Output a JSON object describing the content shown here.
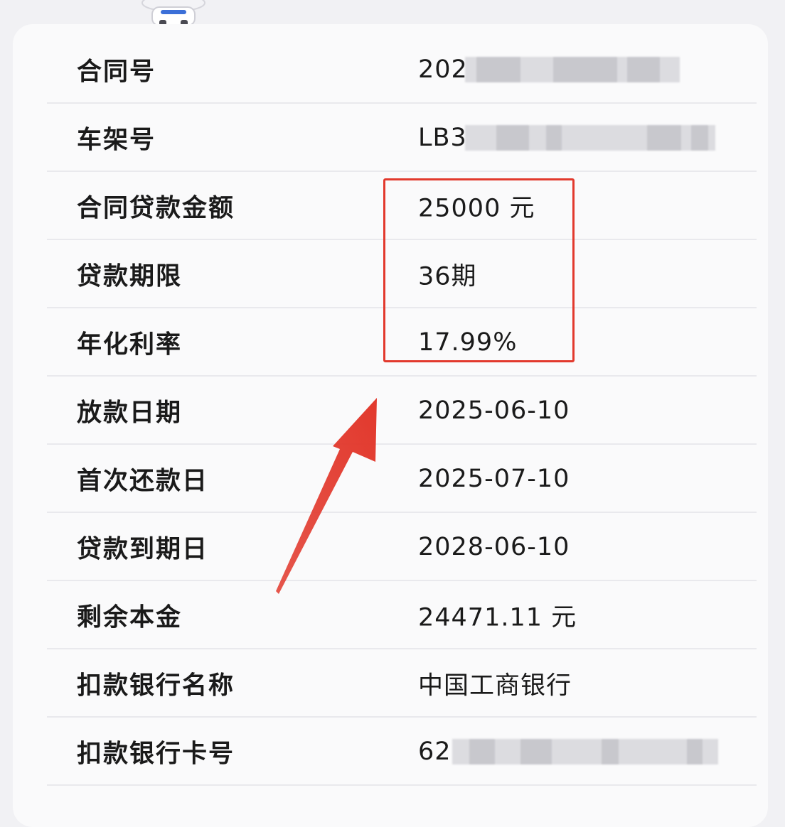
{
  "rows": [
    {
      "label": "合同号",
      "value": "202",
      "masked": true
    },
    {
      "label": "车架号",
      "value": "LB3",
      "masked": true
    },
    {
      "label": "合同贷款金额",
      "value": "25000 元"
    },
    {
      "label": "贷款期限",
      "value": "36期"
    },
    {
      "label": "年化利率",
      "value": "17.99%"
    },
    {
      "label": "放款日期",
      "value": "2025-06-10"
    },
    {
      "label": "首次还款日",
      "value": "2025-07-10"
    },
    {
      "label": "贷款到期日",
      "value": "2028-06-10"
    },
    {
      "label": "剩余本金",
      "value": "24471.11 元"
    },
    {
      "label": "扣款银行名称",
      "value": "中国工商银行"
    },
    {
      "label": "扣款银行卡号",
      "value": "621",
      "masked": true
    }
  ],
  "colors": {
    "highlight": "#e2392d",
    "background": "#f1f1f4",
    "card": "#fafafb"
  }
}
